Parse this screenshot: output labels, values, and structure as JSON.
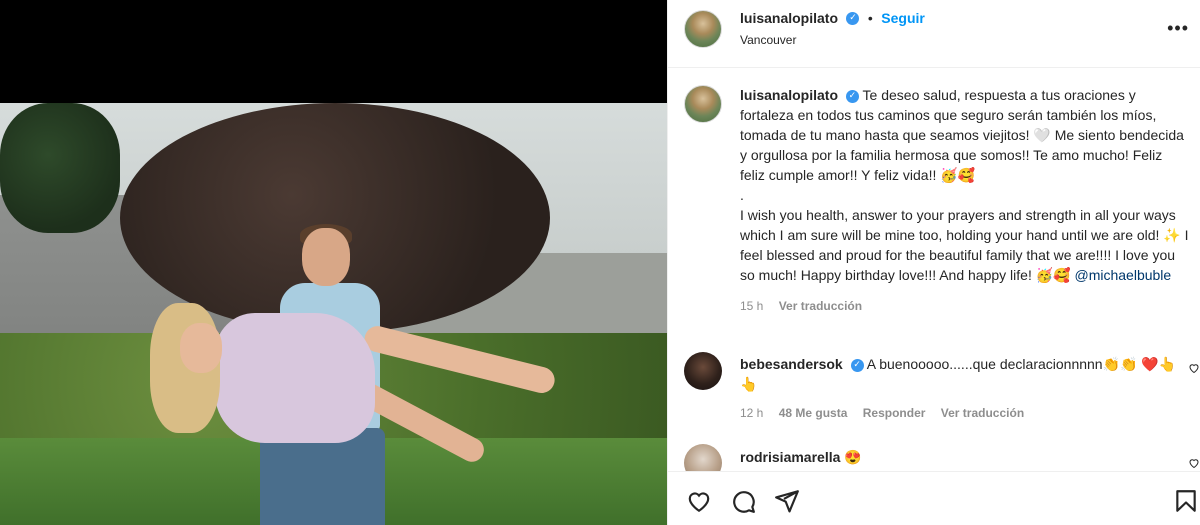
{
  "post": {
    "owner": {
      "username": "luisanalopilato",
      "follow_label": "Seguir",
      "dot": "•",
      "location": "Vancouver",
      "more": "•••"
    },
    "caption": {
      "username": "luisanalopilato",
      "lines": [
        "Te deseo salud, respuesta a tus oraciones y fortaleza en todos tus caminos que seguro serán también los míos, tomada de tu mano hasta que seamos viejitos! 🤍 Me siento bendecida y orgullosa por la familia hermosa que somos!! Te amo mucho! Feliz feliz cumple amor!! Y feliz vida!! 🥳🥰",
        ".",
        "I wish you health, answer to your prayers and strength in all your ways which I am sure will be mine too, holding your hand until we are old! ✨ I feel blessed and proud for the beautiful family that we are!!!! I love you so much! Happy birthday love!!! And happy life! 🥳🥰"
      ],
      "mention": "@michaelbuble",
      "time": "15 h",
      "see_translation": "Ver traducción"
    },
    "comments": [
      {
        "username": "bebesandersok",
        "text": "A buenooooo......que declaracionnnnn👏👏 ❤️👆👆",
        "time": "12 h",
        "likes": "48 Me gusta",
        "reply": "Responder",
        "see_translation": "Ver traducción"
      },
      {
        "username": "rodrisiamarella",
        "text": "😍"
      }
    ]
  },
  "icons": {
    "like": "heart-icon",
    "comment": "comment-icon",
    "share": "share-icon",
    "save": "bookmark-icon",
    "verified": "verified-badge-icon"
  },
  "colors": {
    "accent": "#0095f6",
    "verified": "#3897f0",
    "mention": "#00376b",
    "muted": "#8e8e8e"
  }
}
